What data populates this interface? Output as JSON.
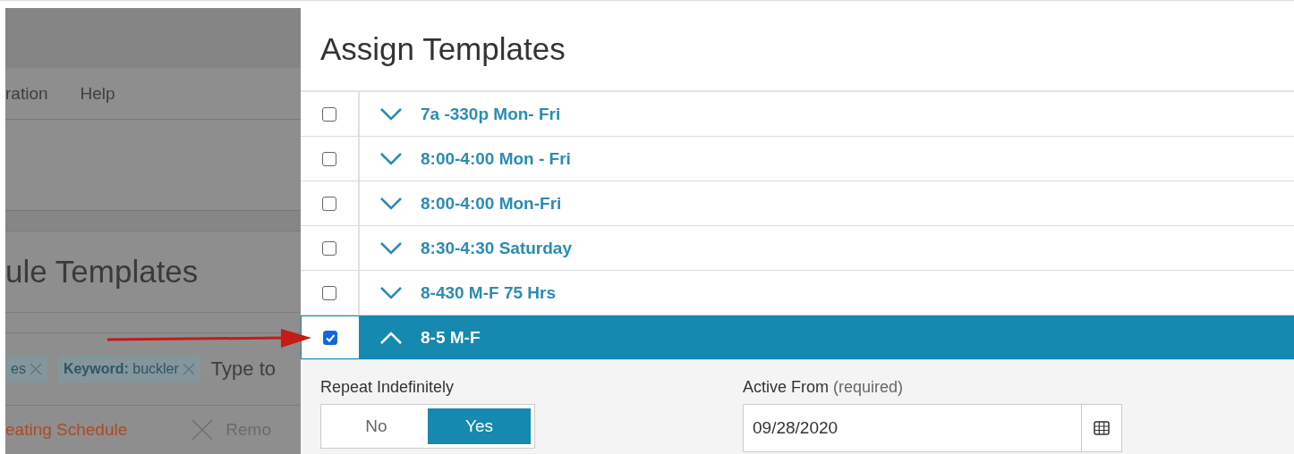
{
  "background": {
    "menu_items": [
      "ration",
      "Help"
    ],
    "page_title": "ule Templates",
    "filter_chips": [
      {
        "text": "es"
      },
      {
        "text": "**Keyword:** buckler"
      }
    ],
    "filter_placeholder": "Type to",
    "actions": [
      {
        "kind": "link",
        "label": "eating Schedule"
      },
      {
        "kind": "remove",
        "label": "Remo"
      }
    ]
  },
  "dialog": {
    "title": "Assign Templates",
    "templates": [
      {
        "name": "7a -330p Mon- Fri",
        "checked": false,
        "expanded": false
      },
      {
        "name": "8:00-4:00 Mon - Fri",
        "checked": false,
        "expanded": false
      },
      {
        "name": "8:00-4:00 Mon-Fri",
        "checked": false,
        "expanded": false
      },
      {
        "name": "8:30-4:30 Saturday",
        "checked": false,
        "expanded": false
      },
      {
        "name": "8-430 M-F 75 Hrs",
        "checked": false,
        "expanded": false
      },
      {
        "name": "8-5 M-F",
        "checked": true,
        "expanded": true
      }
    ],
    "details": {
      "repeat_label": "Repeat Indefinitely",
      "repeat_options": [
        {
          "label": "No",
          "selected": false
        },
        {
          "label": "Yes",
          "selected": true
        }
      ],
      "active_from_label": "Active From",
      "active_from_hint": "(required)",
      "active_from_value": "09/28/2020"
    }
  }
}
